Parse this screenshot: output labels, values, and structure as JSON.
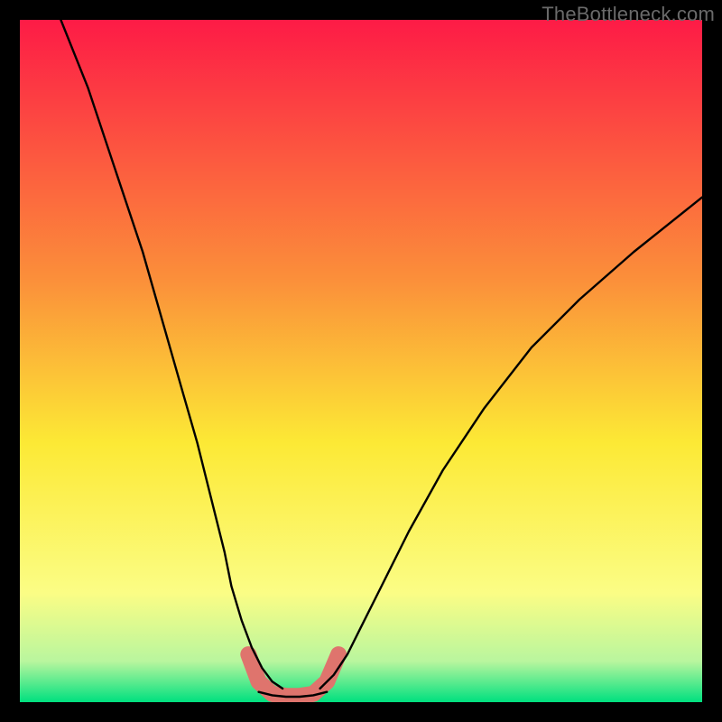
{
  "watermark": "TheBottleneck.com",
  "colors": {
    "gradient_top": "#fd1b46",
    "gradient_mid_upper": "#fb8f3a",
    "gradient_mid": "#fce935",
    "gradient_lower": "#fbfd85",
    "gradient_near_bottom": "#b9f69e",
    "gradient_bottom": "#00e07f",
    "curve": "#000000",
    "low_band": "#df746d",
    "frame": "#000000"
  },
  "chart_data": {
    "type": "line",
    "title": "",
    "xlabel": "",
    "ylabel": "",
    "xlim": [
      0,
      100
    ],
    "ylim": [
      0,
      100
    ],
    "grid": false,
    "legend": false,
    "series": [
      {
        "name": "left_branch",
        "x": [
          6,
          10,
          14,
          18,
          22,
          24,
          26,
          28,
          30,
          31,
          32.5,
          34,
          35.5,
          37,
          38.5
        ],
        "y": [
          100,
          90,
          78,
          66,
          52,
          45,
          38,
          30,
          22,
          17,
          12,
          8,
          5,
          3,
          2
        ]
      },
      {
        "name": "right_branch",
        "x": [
          44,
          46,
          48,
          50,
          53,
          57,
          62,
          68,
          75,
          82,
          90,
          100
        ],
        "y": [
          2,
          4,
          7,
          11,
          17,
          25,
          34,
          43,
          52,
          59,
          66,
          74
        ]
      },
      {
        "name": "valley_floor",
        "x": [
          35,
          37,
          39,
          41,
          43,
          45
        ],
        "y": [
          1.5,
          1,
          0.8,
          0.8,
          1,
          1.5
        ]
      }
    ],
    "annotations": [
      {
        "name": "highlight_low_band",
        "x": [
          33.5,
          35,
          37,
          39,
          41,
          43,
          45,
          46.7
        ],
        "y": [
          7,
          3,
          1.2,
          0.9,
          0.9,
          1.2,
          3,
          7
        ]
      }
    ]
  }
}
